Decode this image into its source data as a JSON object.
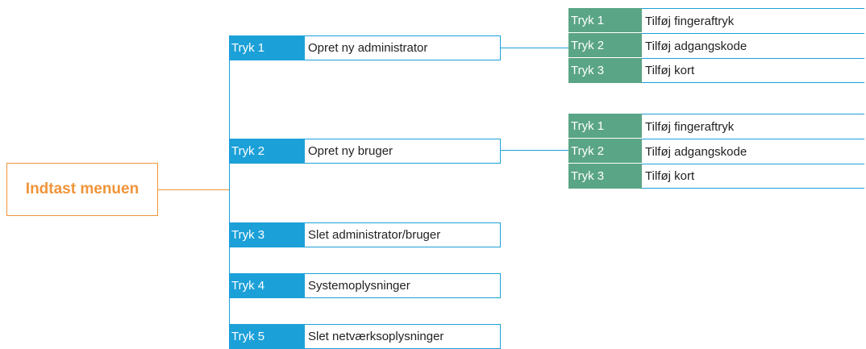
{
  "root": {
    "label": "Indtast menuen"
  },
  "menu": [
    {
      "key": "Tryk 1",
      "label": "Opret ny administrator"
    },
    {
      "key": "Tryk 2",
      "label": "Opret ny bruger"
    },
    {
      "key": "Tryk 3",
      "label": "Slet administrator/bruger"
    },
    {
      "key": "Tryk 4",
      "label": "Systemoplysninger"
    },
    {
      "key": "Tryk 5",
      "label": "Slet netværksoplysninger"
    }
  ],
  "submenus": [
    {
      "parent": "Opret ny administrator",
      "items": [
        {
          "key": "Tryk 1",
          "label": "Tilføj fingeraftryk"
        },
        {
          "key": "Tryk 2",
          "label": "Tilføj adgangskode"
        },
        {
          "key": "Tryk 3",
          "label": "Tilføj kort"
        }
      ]
    },
    {
      "parent": "Opret ny bruger",
      "items": [
        {
          "key": "Tryk 1",
          "label": "Tilføj fingeraftryk"
        },
        {
          "key": "Tryk 2",
          "label": "Tilføj adgangskode"
        },
        {
          "key": "Tryk 3",
          "label": "Tilføj kort"
        }
      ]
    }
  ],
  "colors": {
    "root_accent": "#f0943a",
    "menu_key_bg": "#1ca0d8",
    "sub_key_bg": "#5aa586",
    "connector": "#1ca0d8"
  }
}
